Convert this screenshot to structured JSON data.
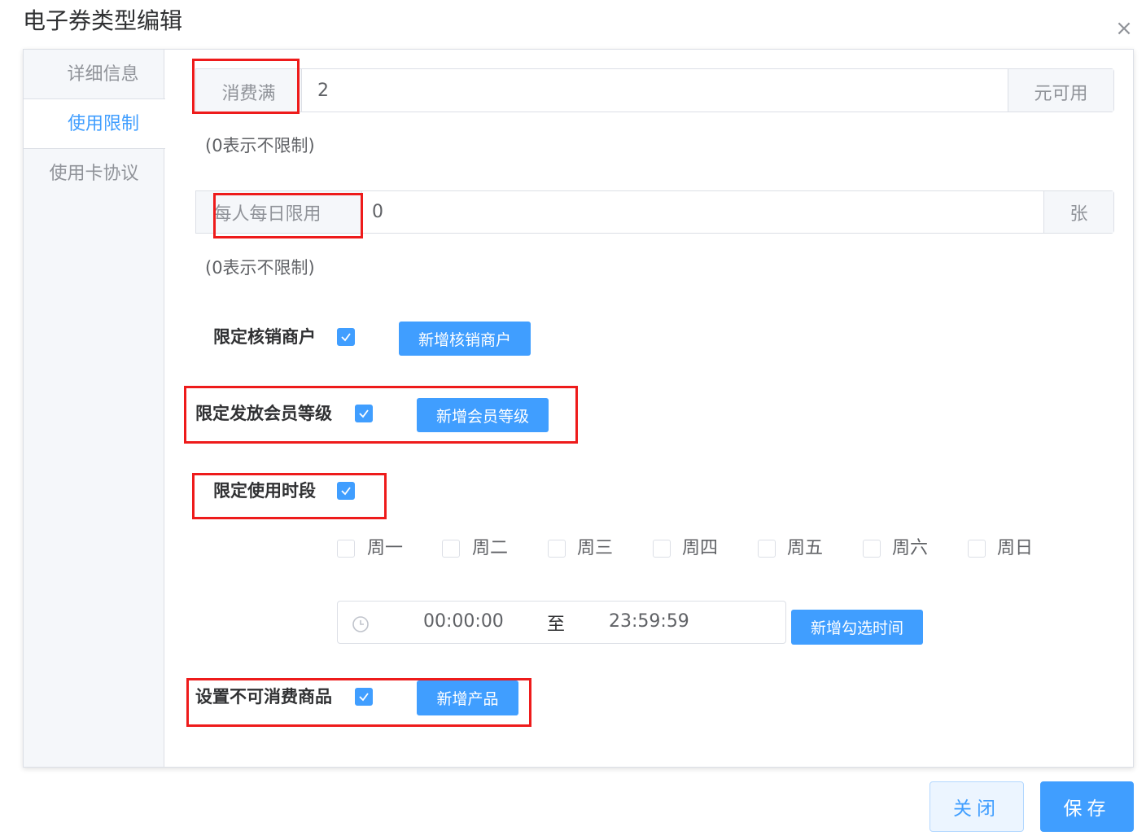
{
  "dialog": {
    "title": "电子券类型编辑",
    "close_icon": "×"
  },
  "sidebar": {
    "items": [
      {
        "label": "详细信息",
        "active": false
      },
      {
        "label": "使用限制",
        "active": true
      },
      {
        "label": "使用卡协议",
        "active": false
      }
    ]
  },
  "spend_min": {
    "prepend": "消费满",
    "value": "2",
    "append": "元可用",
    "hint": "(0表示不限制)"
  },
  "daily_limit": {
    "prepend": "每人每日限用",
    "value": "0",
    "append": "张",
    "hint": "(0表示不限制)"
  },
  "limit_merchant": {
    "label": "限定核销商户",
    "checked": true,
    "button": "新增核销商户"
  },
  "limit_member_level": {
    "label": "限定发放会员等级",
    "checked": true,
    "button": "新增会员等级"
  },
  "limit_time": {
    "label": "限定使用时段",
    "checked": true
  },
  "weekdays": [
    {
      "label": "周一",
      "checked": false
    },
    {
      "label": "周二",
      "checked": false
    },
    {
      "label": "周三",
      "checked": false
    },
    {
      "label": "周四",
      "checked": false
    },
    {
      "label": "周五",
      "checked": false
    },
    {
      "label": "周六",
      "checked": false
    },
    {
      "label": "周日",
      "checked": false
    }
  ],
  "time_range": {
    "start": "00:00:00",
    "separator": "至",
    "end": "23:59:59",
    "button": "新增勾选时间",
    "icon": "clock-icon"
  },
  "exclude_products": {
    "label": "设置不可消费商品",
    "checked": true,
    "button": "新增产品"
  },
  "footer": {
    "close": "关闭",
    "save": "保存"
  },
  "colors": {
    "accent": "#409eff",
    "highlight": "#ee1b1b"
  }
}
